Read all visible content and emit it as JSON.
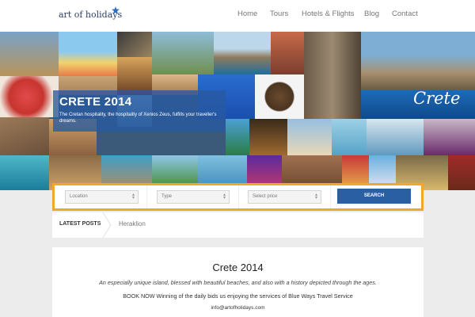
{
  "header": {
    "logo_text": "art of holidays",
    "nav": [
      "Home",
      "Tours",
      "Hotels & Flights",
      "Blog",
      "Contact"
    ]
  },
  "hero": {
    "title": "CRETE 2014",
    "subtitle": "The Cretan hospitality, the hospitality of Xenios Zeus, fulfills your traveller's dreams.",
    "script_caption": "Crete"
  },
  "search": {
    "location_placeholder": "Location",
    "type_placeholder": "Type",
    "price_placeholder": "Select price",
    "button_label": "SEARCH"
  },
  "latest": {
    "label": "LATEST POSTS",
    "item": "Heraklion"
  },
  "content": {
    "title": "Crete 2014",
    "lead": "An especially unique island, blessed with beautiful beaches, and also with a history depicted through the ages.",
    "line": "BOOK NOW Winning of the daily bids us enjoying the services of Blue Ways Travel Service",
    "email": "info@artofholidays.com"
  },
  "colors": {
    "accent_orange": "#f0a82a",
    "button_blue": "#2b5fa4",
    "overlay_blue": "#285aa0",
    "logo_star": "#2b6cc4"
  },
  "icons": {
    "logo_star": "star-icon",
    "select_arrow": "updown-arrow-icon",
    "breadcrumb": "chevron-right-icon"
  }
}
